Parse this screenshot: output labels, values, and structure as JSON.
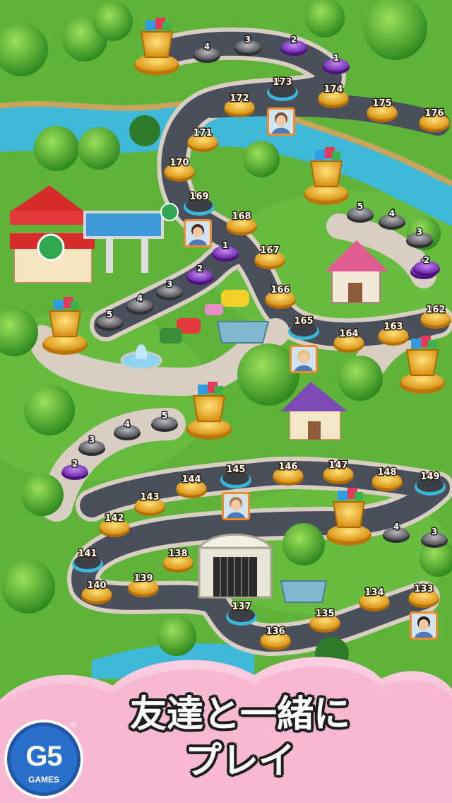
{
  "caption": {
    "line1": "友達と一緒に",
    "line2": "プレイ"
  },
  "logo": {
    "text": "G5",
    "registered": "®",
    "sub": "GAMES"
  },
  "colors": {
    "grass": "#5fb33a",
    "road": "#4a4f5c",
    "river": "#3fb8d9",
    "cleared_node": "#f0b423",
    "subgame_node": "#8b3fc4",
    "locked_node": "#5f6166",
    "banner_pink": "#f6b3cf"
  },
  "main_levels": [
    {
      "label": "133",
      "state": "cleared"
    },
    {
      "label": "134",
      "state": "cleared"
    },
    {
      "label": "135",
      "state": "cleared"
    },
    {
      "label": "136",
      "state": "cleared"
    },
    {
      "label": "137",
      "state": "current"
    },
    {
      "label": "138",
      "state": "cleared"
    },
    {
      "label": "139",
      "state": "cleared"
    },
    {
      "label": "140",
      "state": "cleared"
    },
    {
      "label": "141",
      "state": "current"
    },
    {
      "label": "142",
      "state": "cleared"
    },
    {
      "label": "143",
      "state": "cleared"
    },
    {
      "label": "144",
      "state": "cleared"
    },
    {
      "label": "145",
      "state": "current"
    },
    {
      "label": "146",
      "state": "cleared"
    },
    {
      "label": "147",
      "state": "cleared"
    },
    {
      "label": "148",
      "state": "cleared"
    },
    {
      "label": "149",
      "state": "current"
    },
    {
      "label": "162",
      "state": "cleared"
    },
    {
      "label": "163",
      "state": "cleared"
    },
    {
      "label": "164",
      "state": "cleared"
    },
    {
      "label": "165",
      "state": "current"
    },
    {
      "label": "166",
      "state": "cleared"
    },
    {
      "label": "167",
      "state": "cleared"
    },
    {
      "label": "168",
      "state": "cleared"
    },
    {
      "label": "169",
      "state": "current"
    },
    {
      "label": "170",
      "state": "cleared"
    },
    {
      "label": "171",
      "state": "cleared"
    },
    {
      "label": "172",
      "state": "cleared"
    },
    {
      "label": "173",
      "state": "current"
    },
    {
      "label": "174",
      "state": "cleared"
    },
    {
      "label": "175",
      "state": "cleared"
    },
    {
      "label": "176",
      "state": "cleared"
    }
  ],
  "side_levels": [
    {
      "label": "1",
      "state": "purple"
    },
    {
      "label": "2",
      "state": "purple"
    },
    {
      "label": "3",
      "state": "grey"
    },
    {
      "label": "4",
      "state": "grey"
    },
    {
      "label": "1",
      "state": "purple"
    },
    {
      "label": "2",
      "state": "purple"
    },
    {
      "label": "3",
      "state": "grey"
    },
    {
      "label": "4",
      "state": "grey"
    },
    {
      "label": "5",
      "state": "grey"
    },
    {
      "label": "1",
      "state": "purple"
    },
    {
      "label": "2",
      "state": "purple"
    },
    {
      "label": "3",
      "state": "grey"
    },
    {
      "label": "4",
      "state": "grey"
    },
    {
      "label": "5",
      "state": "grey"
    },
    {
      "label": "2",
      "state": "purple"
    },
    {
      "label": "3",
      "state": "grey"
    },
    {
      "label": "4",
      "state": "grey"
    },
    {
      "label": "5",
      "state": "grey"
    },
    {
      "label": "3",
      "state": "grey"
    },
    {
      "label": "4",
      "state": "grey"
    }
  ],
  "friend_avatars": [
    {
      "name": "friend-avatar-woman-dark"
    },
    {
      "name": "friend-avatar-man"
    },
    {
      "name": "friend-avatar-woman-blonde"
    },
    {
      "name": "friend-avatar-boy"
    },
    {
      "name": "friend-avatar-woman-asian"
    }
  ]
}
